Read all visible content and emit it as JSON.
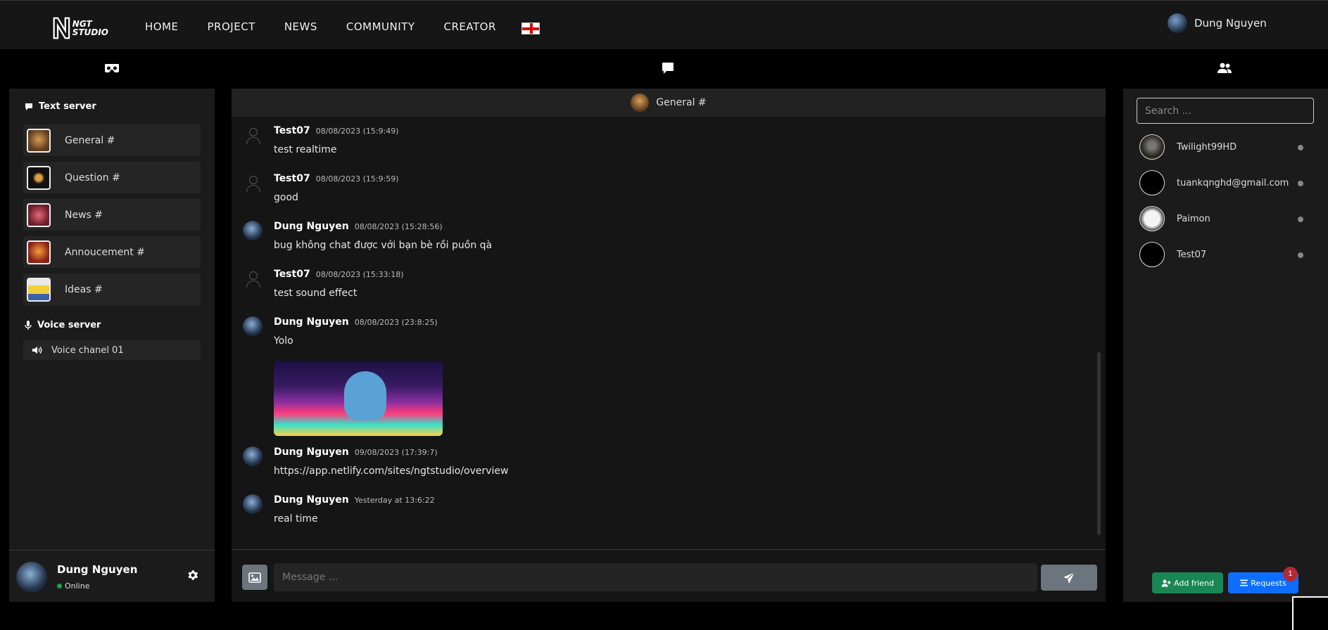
{
  "nav": {
    "logo_line1": "NGT",
    "logo_line2": "STUDIO",
    "links": [
      "HOME",
      "PROJECT",
      "NEWS",
      "COMMUNITY",
      "CREATOR"
    ],
    "user_name": "Dung Nguyen"
  },
  "sidebar": {
    "text_server_title": "Text server",
    "channels": [
      {
        "label": "General #"
      },
      {
        "label": "Question #"
      },
      {
        "label": "News #"
      },
      {
        "label": "Annoucement #"
      },
      {
        "label": "Ideas #"
      }
    ],
    "voice_server_title": "Voice server",
    "voice_channel": "Voice chanel 01",
    "user": {
      "name": "Dung Nguyen",
      "status": "Online"
    }
  },
  "chat": {
    "header": "General #",
    "messages": [
      {
        "name": "Test07",
        "time": "08/08/2023 (15:9:49)",
        "text": "test realtime"
      },
      {
        "name": "Test07",
        "time": "08/08/2023 (15:9:59)",
        "text": "good"
      },
      {
        "name": "Dung Nguyen",
        "time": "08/08/2023 (15:28:56)",
        "text": "bug không chat được với bạn bè rồi puồn qà"
      },
      {
        "name": "Test07",
        "time": "08/08/2023 (15:33:18)",
        "text": "test sound effect"
      },
      {
        "name": "Dung Nguyen",
        "time": "08/08/2023 (23:8:25)",
        "text": "Yolo"
      },
      {
        "name": "Dung Nguyen",
        "time": "09/08/2023 (17:39:7)",
        "text": "https://app.netlify.com/sites/ngtstudio/overview"
      },
      {
        "name": "Dung Nguyen",
        "time": "Yesterday at 13:6:22",
        "text": "real time"
      }
    ],
    "input_placeholder": "Message ..."
  },
  "friends": {
    "search_placeholder": "Search ...",
    "list": [
      {
        "name": "Twilight99HD"
      },
      {
        "name": "tuankqnghd@gmail.com"
      },
      {
        "name": "Paimon"
      },
      {
        "name": "Test07"
      }
    ],
    "add_label": "Add friend",
    "requests_label": "Requests",
    "requests_count": "1"
  },
  "colors": {
    "add_green": "#198754",
    "requests_blue": "#0d6efd",
    "badge_red": "#b02a37",
    "online_green": "#1ea34a"
  }
}
